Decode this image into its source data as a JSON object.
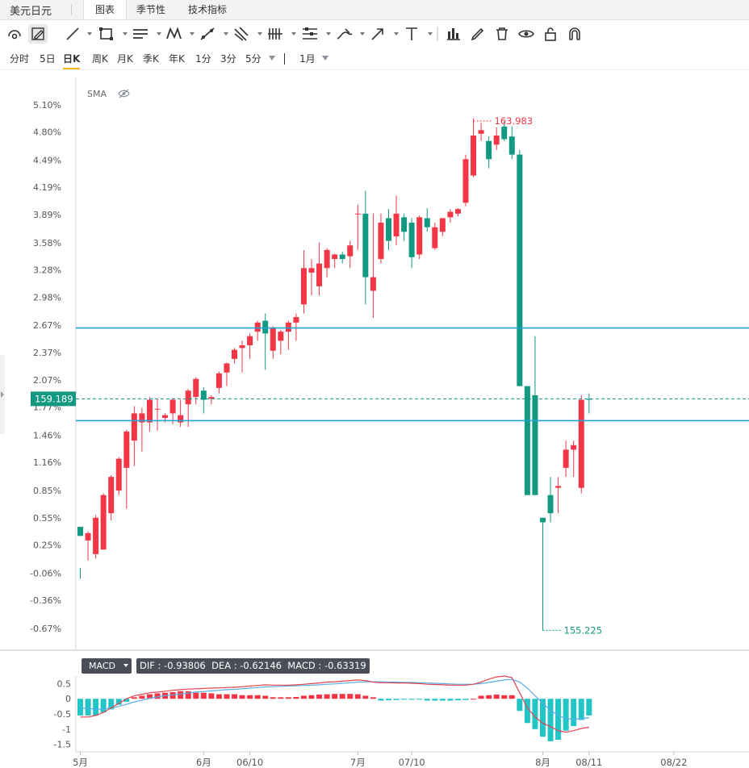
{
  "header": {
    "pair_name": "美元日元",
    "tabs": [
      {
        "label": "图表",
        "active": true
      },
      {
        "label": "季节性",
        "active": false
      },
      {
        "label": "技术指标",
        "active": false
      }
    ]
  },
  "toolbar": {
    "icons": [
      "circle-arc-icon",
      "pencil-box-icon",
      "line-icon",
      "rectangle-icon",
      "parallel-lines-icon",
      "zigzag-icon",
      "ruler-icon",
      "fork-icon",
      "bars-icon",
      "fib-icon",
      "brush-icon",
      "arrow-icon",
      "text-icon",
      "bar-chart-icon",
      "pen-icon",
      "trash-icon",
      "eye-icon",
      "lock-icon",
      "magnet-icon"
    ]
  },
  "periods": {
    "items": [
      "分时",
      "5日",
      "日K",
      "周K",
      "月K",
      "季K",
      "年K",
      "1分",
      "3分",
      "5分"
    ],
    "active": "日K",
    "range_label": "1月"
  },
  "colors": {
    "up": "#f23645",
    "down": "#139981",
    "level_line": "#1fa3d8",
    "price_tag": "#139981",
    "dif": "#e0454f",
    "dea": "#5aaee8",
    "macd_up": "#f23645",
    "macd_down": "#22c5c5"
  },
  "chart_data": [
    {
      "type": "candlestick",
      "indicator_label": "SMA",
      "y_axis_unit": "percent change",
      "y_ticks": [
        "5.10%",
        "4.80%",
        "4.49%",
        "4.19%",
        "3.89%",
        "3.58%",
        "3.28%",
        "2.98%",
        "2.67%",
        "2.37%",
        "2.07%",
        "1.77%",
        "1.46%",
        "1.16%",
        "0.85%",
        "0.55%",
        "0.25%",
        "-0.06%",
        "-0.36%",
        "-0.67%"
      ],
      "y_tick_values": [
        5.1,
        4.8,
        4.49,
        4.19,
        3.89,
        3.58,
        3.28,
        2.98,
        2.67,
        2.37,
        2.07,
        1.77,
        1.46,
        1.16,
        0.85,
        0.55,
        0.25,
        -0.06,
        -0.36,
        -0.67
      ],
      "y_range": [
        -0.9,
        5.4
      ],
      "x_labels": [
        "5月",
        "6月",
        "06/10",
        "7月",
        "07/10",
        "8月",
        "08/11",
        "08/22"
      ],
      "x_label_index": [
        0,
        16,
        22,
        36,
        43,
        60,
        66,
        77
      ],
      "current_price": "159.189",
      "current_value": 1.86,
      "high_label": "163.983",
      "high_value": 4.92,
      "low_label": "155.225",
      "low_value": -0.69,
      "horizontal_levels": [
        2.64,
        1.62
      ],
      "candles": [
        [
          0.45,
          0.35,
          -0.12,
          0.0
        ],
        [
          0.3,
          0.38,
          0.08,
          0.4
        ],
        [
          0.15,
          0.55,
          0.1,
          0.58
        ],
        [
          0.2,
          0.8,
          0.25,
          0.82
        ],
        [
          0.6,
          1.0,
          0.52,
          1.02
        ],
        [
          0.85,
          1.2,
          0.8,
          1.22
        ],
        [
          1.1,
          1.5,
          0.65,
          1.52
        ],
        [
          1.4,
          1.7,
          1.12,
          1.78
        ],
        [
          1.6,
          1.7,
          1.28,
          1.76
        ],
        [
          1.6,
          1.85,
          1.5,
          1.88
        ],
        [
          1.75,
          1.75,
          1.51,
          1.86
        ],
        [
          1.65,
          1.68,
          1.6,
          1.7
        ],
        [
          1.7,
          1.85,
          1.58,
          1.87
        ],
        [
          1.6,
          1.68,
          1.55,
          1.85
        ],
        [
          1.8,
          1.95,
          1.55,
          1.97
        ],
        [
          1.88,
          2.08,
          1.8,
          2.1
        ],
        [
          1.95,
          1.85,
          1.7,
          1.99
        ],
        [
          1.86,
          1.88,
          1.8,
          1.9
        ],
        [
          1.98,
          2.14,
          1.92,
          2.16
        ],
        [
          2.15,
          2.25,
          2.0,
          2.26
        ],
        [
          2.3,
          2.4,
          2.25,
          2.42
        ],
        [
          2.42,
          2.45,
          2.15,
          2.5
        ],
        [
          2.45,
          2.55,
          2.3,
          2.58
        ],
        [
          2.6,
          2.7,
          2.5,
          2.72
        ],
        [
          2.72,
          2.58,
          2.18,
          2.8
        ],
        [
          2.39,
          2.64,
          2.3,
          2.66
        ],
        [
          2.5,
          2.6,
          2.35,
          2.62
        ],
        [
          2.6,
          2.7,
          2.4,
          2.72
        ],
        [
          2.7,
          2.76,
          2.5,
          2.8
        ],
        [
          2.9,
          3.3,
          2.8,
          3.5
        ],
        [
          3.25,
          3.3,
          3.0,
          3.4
        ],
        [
          3.1,
          3.35,
          3.0,
          3.58
        ],
        [
          3.3,
          3.5,
          3.2,
          3.52
        ],
        [
          3.4,
          3.45,
          3.3,
          3.46
        ],
        [
          3.45,
          3.4,
          3.35,
          3.48
        ],
        [
          3.43,
          3.55,
          3.3,
          3.6
        ],
        [
          3.9,
          3.9,
          3.5,
          4.0
        ],
        [
          3.9,
          3.2,
          2.9,
          4.15
        ],
        [
          3.05,
          3.2,
          2.75,
          3.9
        ],
        [
          3.4,
          3.8,
          3.35,
          3.9
        ],
        [
          3.85,
          3.6,
          3.5,
          3.95
        ],
        [
          3.65,
          3.9,
          3.55,
          4.1
        ],
        [
          3.86,
          3.7,
          3.6,
          3.9
        ],
        [
          3.8,
          3.42,
          3.3,
          3.85
        ],
        [
          3.45,
          3.86,
          3.4,
          3.88
        ],
        [
          3.85,
          3.75,
          3.7,
          3.96
        ],
        [
          3.52,
          3.75,
          3.5,
          3.8
        ],
        [
          3.7,
          3.85,
          3.65,
          3.85
        ],
        [
          3.86,
          3.92,
          3.8,
          3.95
        ],
        [
          3.9,
          3.95,
          3.87,
          3.96
        ],
        [
          4.02,
          4.5,
          3.98,
          4.55
        ],
        [
          4.32,
          4.76,
          4.3,
          4.95
        ],
        [
          4.78,
          4.82,
          4.7,
          4.9
        ],
        [
          4.7,
          4.5,
          4.4,
          4.75
        ],
        [
          4.66,
          4.76,
          4.6,
          4.85
        ],
        [
          4.86,
          4.72,
          4.7,
          4.92
        ],
        [
          4.75,
          4.55,
          4.5,
          4.86
        ],
        [
          4.55,
          2.0,
          2.0,
          4.6
        ],
        [
          2.0,
          0.8,
          0.8,
          2.0
        ],
        [
          1.9,
          0.8,
          0.8,
          2.55
        ],
        [
          0.55,
          0.5,
          -0.69,
          0.55
        ],
        [
          0.8,
          0.6,
          0.5,
          1.0
        ],
        [
          0.88,
          0.9,
          0.6,
          1.0
        ],
        [
          1.1,
          1.3,
          1.0,
          1.4
        ],
        [
          1.3,
          1.35,
          1.0,
          1.4
        ],
        [
          0.88,
          1.85,
          0.82,
          1.9
        ],
        [
          1.86,
          1.85,
          1.7,
          1.92
        ]
      ]
    },
    {
      "type": "bar",
      "name": "MACD",
      "dif_label": "DIF : -0.93806",
      "dea_label": "DEA : -0.62146",
      "macd_label": "MACD : -0.63319",
      "y_ticks": [
        "0.5",
        "0",
        "-0.5",
        "-1",
        "-1.5"
      ],
      "y_tick_values": [
        0.5,
        0,
        -0.5,
        -1,
        -1.5
      ],
      "y_range": [
        -1.75,
        0.75
      ],
      "macd": [
        -0.55,
        -0.55,
        -0.55,
        -0.45,
        -0.35,
        -0.2,
        -0.1,
        0.05,
        0.1,
        0.15,
        0.18,
        0.2,
        0.22,
        0.25,
        0.25,
        0.2,
        0.2,
        0.18,
        0.15,
        0.15,
        0.15,
        0.12,
        0.12,
        0.12,
        0.1,
        0.05,
        0.05,
        0.05,
        0.06,
        0.1,
        0.12,
        0.14,
        0.15,
        0.16,
        0.16,
        0.16,
        0.15,
        0.1,
        0.05,
        -0.06,
        -0.05,
        -0.04,
        -0.03,
        -0.03,
        -0.02,
        -0.06,
        -0.06,
        -0.06,
        -0.06,
        -0.05,
        -0.04,
        0.0,
        0.1,
        0.12,
        0.14,
        0.12,
        0.12,
        -0.4,
        -0.8,
        -1.0,
        -1.25,
        -1.4,
        -1.35,
        -1.05,
        -0.9,
        -0.7,
        -0.55
      ],
      "dif": [
        -0.6,
        -0.6,
        -0.55,
        -0.45,
        -0.3,
        -0.15,
        0.0,
        0.1,
        0.15,
        0.2,
        0.22,
        0.25,
        0.28,
        0.3,
        0.32,
        0.33,
        0.34,
        0.35,
        0.36,
        0.37,
        0.38,
        0.4,
        0.42,
        0.44,
        0.46,
        0.45,
        0.45,
        0.45,
        0.46,
        0.48,
        0.5,
        0.52,
        0.55,
        0.56,
        0.58,
        0.6,
        0.62,
        0.6,
        0.55,
        0.53,
        0.53,
        0.52,
        0.52,
        0.51,
        0.5,
        0.48,
        0.47,
        0.46,
        0.45,
        0.45,
        0.45,
        0.48,
        0.55,
        0.65,
        0.72,
        0.75,
        0.7,
        0.2,
        -0.3,
        -0.6,
        -0.8,
        -0.92,
        -1.05,
        -1.1,
        -1.05,
        -0.98,
        -0.94
      ],
      "dea": [
        -0.3,
        -0.32,
        -0.34,
        -0.35,
        -0.3,
        -0.25,
        -0.18,
        -0.1,
        -0.05,
        0.02,
        0.06,
        0.1,
        0.13,
        0.16,
        0.19,
        0.22,
        0.24,
        0.26,
        0.28,
        0.3,
        0.31,
        0.33,
        0.35,
        0.37,
        0.39,
        0.4,
        0.41,
        0.42,
        0.43,
        0.44,
        0.45,
        0.46,
        0.48,
        0.49,
        0.51,
        0.53,
        0.55,
        0.56,
        0.56,
        0.56,
        0.55,
        0.55,
        0.54,
        0.54,
        0.53,
        0.52,
        0.51,
        0.5,
        0.49,
        0.48,
        0.48,
        0.48,
        0.5,
        0.54,
        0.58,
        0.62,
        0.64,
        0.55,
        0.35,
        0.1,
        -0.15,
        -0.38,
        -0.55,
        -0.65,
        -0.68,
        -0.66,
        -0.62
      ]
    }
  ]
}
